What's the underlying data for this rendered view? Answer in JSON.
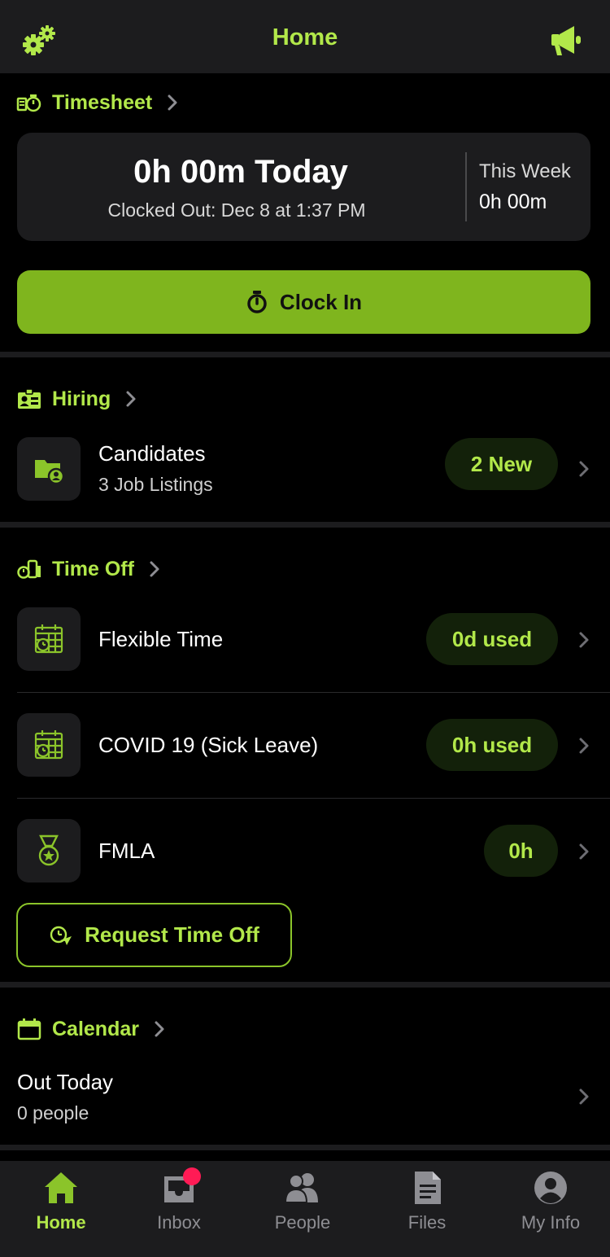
{
  "header": {
    "title": "Home",
    "settings_icon": "gears-icon",
    "announce_icon": "megaphone-icon"
  },
  "colors": {
    "accent": "#b2e84a",
    "button": "#7fb51e",
    "badge": "#ff1b55",
    "background": "#000000",
    "card": "#1c1c1e"
  },
  "timesheet": {
    "title": "Timesheet",
    "today": "0h 00m Today",
    "clocked_out": "Clocked Out: Dec 8 at 1:37 PM",
    "week_label": "This Week",
    "week_value": "0h 00m",
    "clock_in_label": "Clock In"
  },
  "hiring": {
    "title": "Hiring",
    "candidates_label": "Candidates",
    "job_listings": "3 Job Listings",
    "new_badge": "2 New"
  },
  "time_off": {
    "title": "Time Off",
    "items": [
      {
        "label": "Flexible Time",
        "value": "0d used",
        "icon": "calendar-clock-icon"
      },
      {
        "label": "COVID 19 (Sick Leave)",
        "value": "0h used",
        "icon": "calendar-clock-icon"
      },
      {
        "label": "FMLA",
        "value": "0h",
        "icon": "medal-icon"
      }
    ],
    "request_label": "Request Time Off"
  },
  "calendar": {
    "title": "Calendar",
    "out_today_label": "Out Today",
    "out_today_count": "0 people"
  },
  "tabbar": {
    "tabs": [
      {
        "label": "Home",
        "icon": "home-icon",
        "active": true
      },
      {
        "label": "Inbox",
        "icon": "inbox-icon",
        "active": false
      },
      {
        "label": "People",
        "icon": "people-icon",
        "active": false
      },
      {
        "label": "Files",
        "icon": "files-icon",
        "active": false
      },
      {
        "label": "My Info",
        "icon": "user-icon",
        "active": false
      }
    ]
  }
}
